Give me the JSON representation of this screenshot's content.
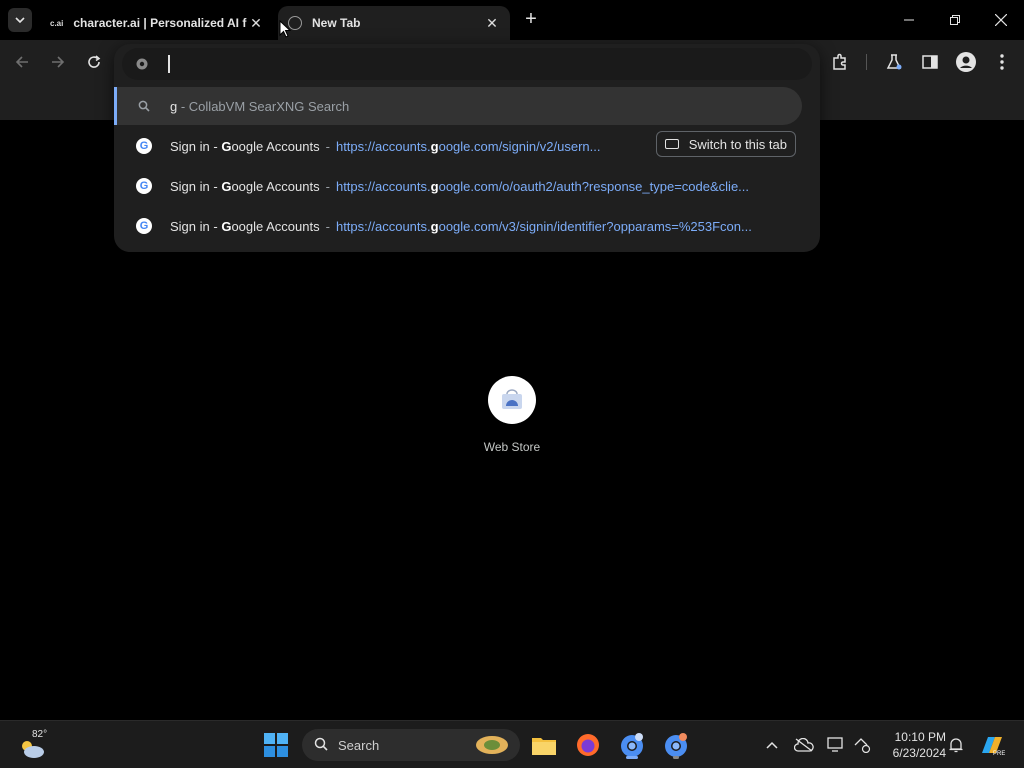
{
  "browser": {
    "tabs": [
      {
        "favicon_text": "c.ai",
        "title": "character.ai | Personalized AI f",
        "active": false
      },
      {
        "favicon_text": "",
        "title": "New Tab",
        "active": true
      }
    ]
  },
  "omnibox": {
    "value": "",
    "suggestions": [
      {
        "type": "search",
        "query": "g",
        "separator": " - ",
        "provider": "CollabVM SearXNG Search"
      },
      {
        "type": "history",
        "title_bold": "G",
        "title_pre": "Sign in - ",
        "title_post": "oogle Accounts",
        "separator": " - ",
        "url_pre": "https://accounts.",
        "url_bold": "g",
        "url_post": "oogle.com/signin/v2/usern...",
        "switch_label": "Switch to this tab"
      },
      {
        "type": "history",
        "title_bold": "G",
        "title_pre": "Sign in - ",
        "title_post": "oogle Accounts",
        "separator": " - ",
        "url_pre": "https://accounts.",
        "url_bold": "g",
        "url_post": "oogle.com/o/oauth2/auth?response_type=code&clie..."
      },
      {
        "type": "history",
        "title_bold": "G",
        "title_pre": "Sign in - ",
        "title_post": "oogle Accounts",
        "separator": " - ",
        "url_pre": "https://accounts.",
        "url_bold": "g",
        "url_post": "oogle.com/v3/signin/identifier?opparams=%253Fcon..."
      }
    ]
  },
  "new_tab": {
    "shortcut_label": "Web Store"
  },
  "taskbar": {
    "weather_temp": "82°",
    "search_placeholder": "Search",
    "time": "10:10 PM",
    "date": "6/23/2024"
  },
  "colors": {
    "accent_blue": "#7cacf8",
    "popup_bg": "#1f1f1f",
    "selected_row": "#333333"
  }
}
